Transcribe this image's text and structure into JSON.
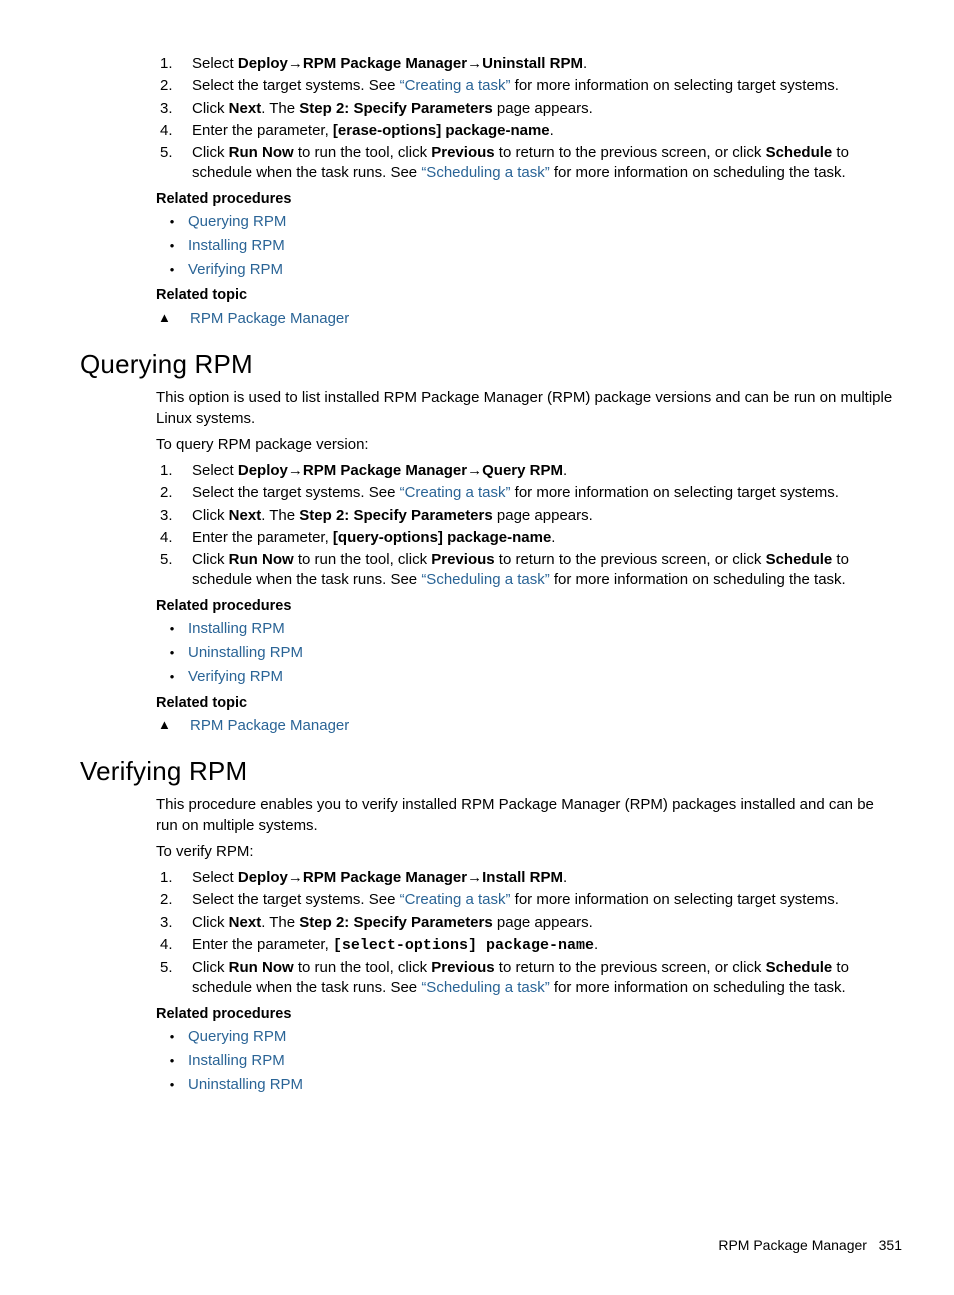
{
  "uninstall": {
    "steps": {
      "s1_pre": "Select ",
      "s1_nav1": "Deploy",
      "s1_nav2": "RPM Package Manager",
      "s1_nav3": "Uninstall RPM",
      "s2_pre": "Select the target systems. See ",
      "s2_link": "“Creating a task”",
      "s2_post": " for more information on selecting target systems.",
      "s3_pre": "Click ",
      "s3_b1": "Next",
      "s3_mid": ". The ",
      "s3_b2": "Step 2: Specify Parameters",
      "s3_post": " page appears.",
      "s4_pre": "Enter the parameter, ",
      "s4_b": "[erase-options] package-name",
      "s4_post": ".",
      "s5_pre": "Click ",
      "s5_b1": "Run Now",
      "s5_mid1": " to run the tool, click ",
      "s5_b2": "Previous",
      "s5_mid2": " to return to the previous screen, or click ",
      "s5_b3": "Schedule",
      "s5_mid3": " to schedule when the task runs. See ",
      "s5_link": "“Scheduling a task”",
      "s5_post": " for more information on scheduling the task."
    },
    "rel_proc_title": "Related procedures",
    "rel_proc_items": [
      "Querying RPM",
      "Installing RPM",
      "Verifying RPM"
    ],
    "rel_topic_title": "Related topic",
    "rel_topic_item": "RPM Package Manager"
  },
  "query": {
    "heading": "Querying RPM",
    "intro": "This option is used to list installed RPM Package Manager (RPM) package versions and can be run on multiple Linux systems.",
    "lead": "To query RPM package version:",
    "steps": {
      "s1_nav3": "Query RPM",
      "s4_b": "[query-options] package-name"
    },
    "rel_proc_items": [
      "Installing RPM",
      "Uninstalling RPM",
      "Verifying RPM"
    ]
  },
  "verify": {
    "heading": "Verifying RPM",
    "intro": "This procedure enables you to verify installed RPM Package Manager (RPM) packages installed and can be run on multiple systems.",
    "lead": "To verify RPM:",
    "steps": {
      "s1_nav3": "Install RPM",
      "s4_b": "[select-options] package-name"
    },
    "rel_proc_items": [
      "Querying RPM",
      "Installing RPM",
      "Uninstalling RPM"
    ]
  },
  "common": {
    "arrow": "→",
    "bullet": "•",
    "triangle": "▲",
    "nums": [
      "1.",
      "2.",
      "3.",
      "4.",
      "5."
    ]
  },
  "footer": {
    "label": "RPM Package Manager",
    "page": "351"
  }
}
